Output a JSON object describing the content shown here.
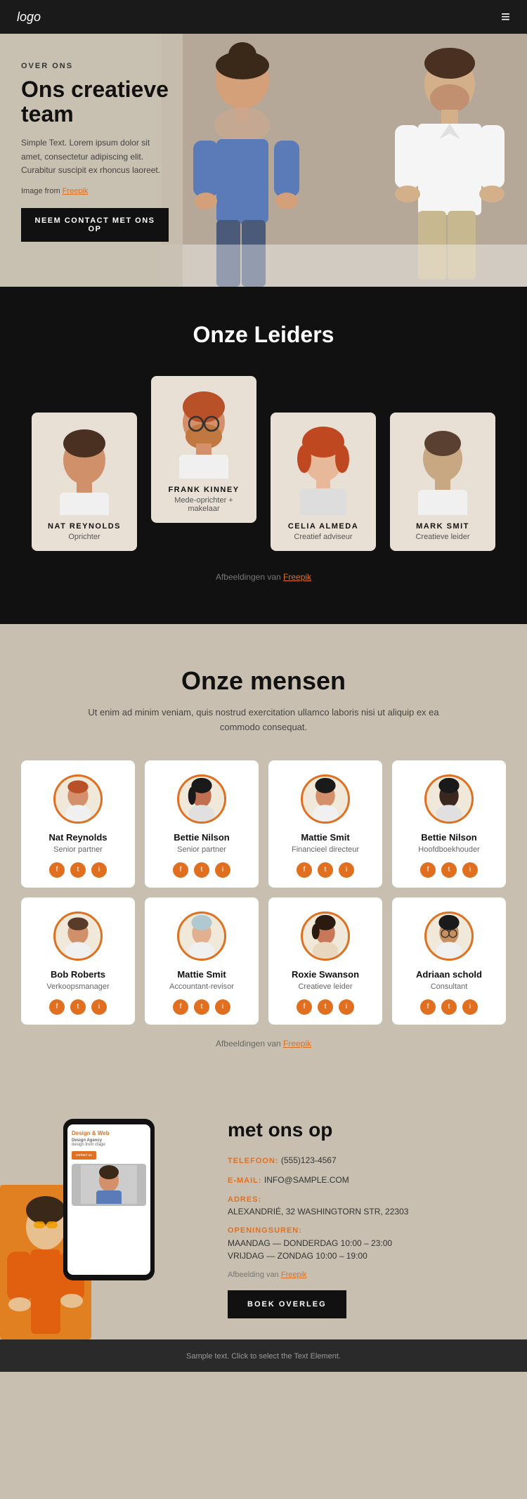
{
  "navbar": {
    "logo": "logo",
    "menu_icon": "≡"
  },
  "hero": {
    "overline": "OVER ONS",
    "title": "Ons creatieve team",
    "description": "Simple Text. Lorem ipsum dolor sit amet, consectetur adipiscing elit. Curabitur suscipit ex rhoncus laoreet.",
    "image_credit_text": "Image from",
    "image_credit_link": "Freepik",
    "cta_button": "NEEM CONTACT MET ONS OP"
  },
  "leiders": {
    "section_title": "Onze Leiders",
    "people": [
      {
        "name": "NAT REYNOLDS",
        "role": "Oprichter",
        "featured": false
      },
      {
        "name": "FRANK KINNEY",
        "role": "Mede-oprichter + makelaar",
        "featured": true
      },
      {
        "name": "CELIA ALMEDA",
        "role": "Creatief adviseur",
        "featured": false
      },
      {
        "name": "MARK SMIT",
        "role": "Creatieve leider",
        "featured": false
      }
    ],
    "attribution_text": "Afbeeldingen van",
    "attribution_link": "Freepik"
  },
  "mensen": {
    "section_title": "Onze mensen",
    "description": "Ut enim ad minim veniam, quis nostrud exercitation ullamco laboris nisi ut aliquip ex ea commodo consequat.",
    "people": [
      {
        "name": "Nat Reynolds",
        "role": "Senior partner",
        "avatar_color": "#e07020"
      },
      {
        "name": "Bettie Nilson",
        "role": "Senior partner",
        "avatar_color": "#e07020"
      },
      {
        "name": "Mattie Smit",
        "role": "Financieel directeur",
        "avatar_color": "#e07020"
      },
      {
        "name": "Bettie Nilson",
        "role": "Hoofdboekhouder",
        "avatar_color": "#e07020"
      },
      {
        "name": "Bob Roberts",
        "role": "Verkoopsmanager",
        "avatar_color": "#e07020"
      },
      {
        "name": "Mattie Smit",
        "role": "Accountant-revisor",
        "avatar_color": "#e07020"
      },
      {
        "name": "Roxie Swanson",
        "role": "Creatieve leider",
        "avatar_color": "#e07020"
      },
      {
        "name": "Adriaan schold",
        "role": "Consultant",
        "avatar_color": "#e07020"
      }
    ],
    "attribution_text": "Afbeeldingen van",
    "attribution_link": "Freepik"
  },
  "contact": {
    "title": "met ons op",
    "phone_label": "TELEFOON:",
    "phone_value": "(555)123-4567",
    "email_label": "E-MAIL:",
    "email_value": "INFO@SAMPLE.COM",
    "address_label": "ADRES:",
    "address_value": "ALEXANDRIÉ, 32 WASHINGTORN STR, 22303",
    "hours_label": "OPENINGSUREN:",
    "hours_value1": "MAANDAG — DONDERDAG 10:00 – 23:00",
    "hours_value2": "VRIJDAG — ZONDAG 10:00 – 19:00",
    "attribution_text": "Afbeelding van",
    "attribution_link": "Freepik",
    "cta_button": "BOEK OVERLEG",
    "phone_screen_title": "Design & Web",
    "phone_screen_sub2": "Design Agency",
    "phone_screen_sub3": "design from cfage",
    "phone_screen_btn": "contact us"
  },
  "footer": {
    "text": "Sample text. Click to select the Text Element."
  },
  "people_avatars": {
    "nat_reynolds_leader": {
      "skin": "#d4a574",
      "hair": "#4a3728"
    },
    "frank_kinney": {
      "skin": "#d4a574",
      "hair": "#b85c38"
    },
    "celia_almeda": {
      "skin": "#e8b89a",
      "hair": "#c45a2a"
    },
    "mark_smit": {
      "skin": "#c8a882",
      "hair": "#5a4030"
    },
    "nat_mensen": {
      "skin": "#d4a070",
      "hair": "#b85030"
    },
    "bettie_1": {
      "skin": "#c07050",
      "hair": "#1a1a1a"
    },
    "mattie_fin": {
      "skin": "#d4906a",
      "hair": "#1a1a1a"
    },
    "bettie_2": {
      "skin": "#3a2820",
      "hair": "#1a1a1a"
    },
    "bob": {
      "skin": "#d0906a",
      "hair": "#5a3a28"
    },
    "mattie_acc": {
      "skin": "#e0b090",
      "hair": "#b0c8d0"
    },
    "roxie": {
      "skin": "#c87858",
      "hair": "#1a1a1a"
    },
    "adriaan": {
      "skin": "#c89060",
      "hair": "#1a1a1a"
    }
  }
}
